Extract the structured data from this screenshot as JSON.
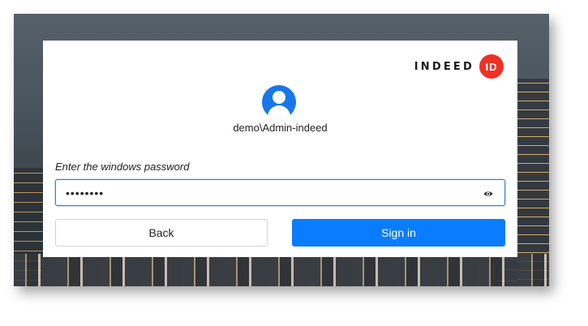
{
  "brand": {
    "logo_text": "INDEED",
    "logo_badge": "ID",
    "badge_color": "#ef3124"
  },
  "user": {
    "avatar_icon": "user-avatar-icon",
    "avatar_color": "#1976e8",
    "name": "demo\\Admin-indeed"
  },
  "password": {
    "label": "Enter the windows password",
    "masked_value": "••••••••",
    "reveal_icon": "eye-icon"
  },
  "buttons": {
    "back_label": "Back",
    "signin_label": "Sign in",
    "signin_color": "#0a7cff"
  }
}
